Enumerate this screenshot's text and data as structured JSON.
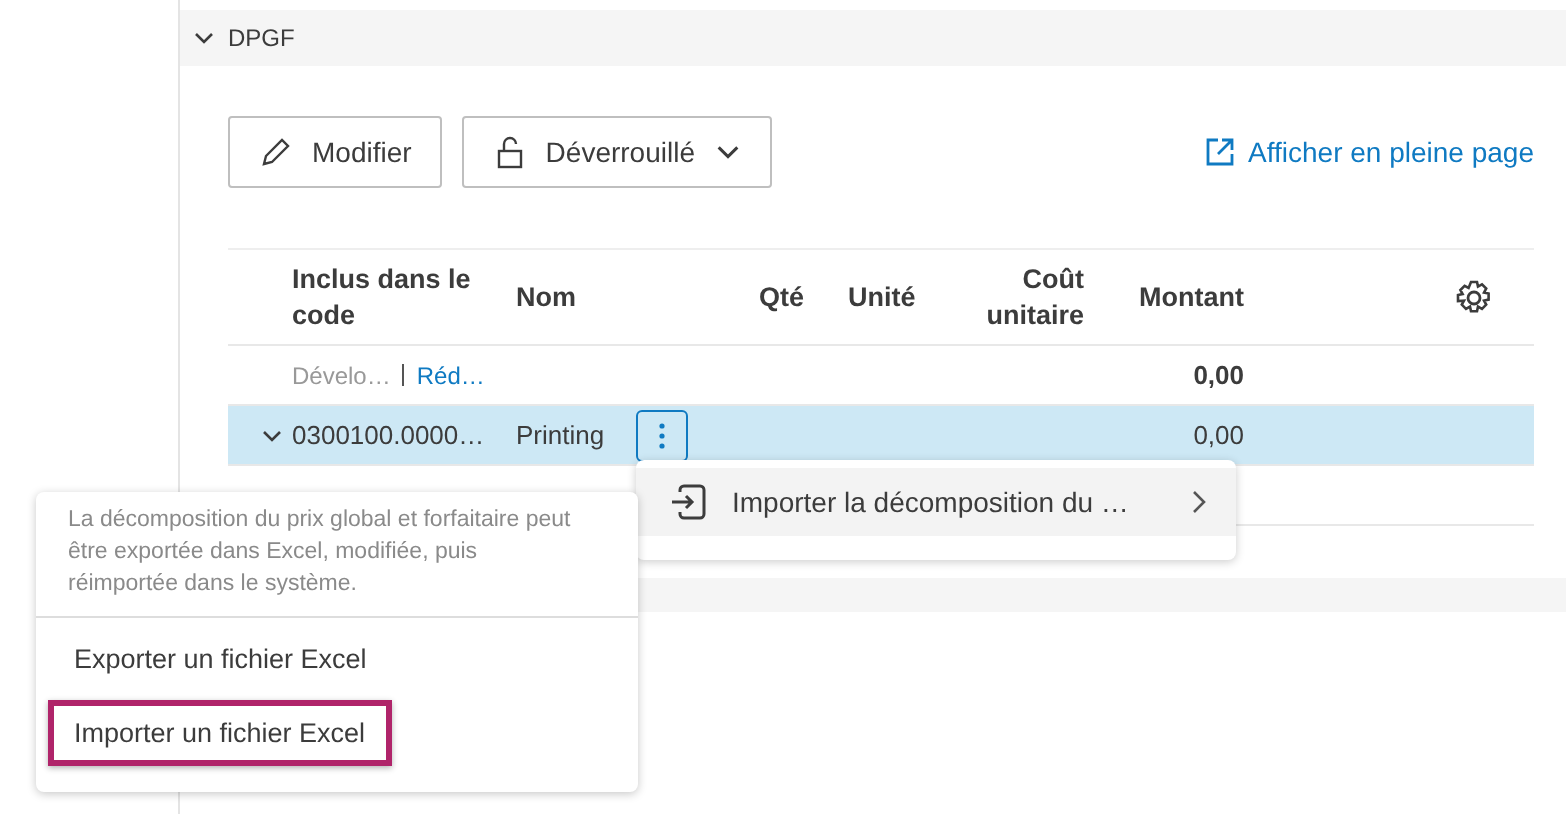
{
  "section": {
    "title": "DPGF",
    "expanded": true
  },
  "toolbar": {
    "edit_button": "Modifier",
    "lock_button": "Déverrouillé",
    "open_link": "Afficher en pleine page"
  },
  "table": {
    "columns": [
      "Inclus dans le code",
      "Nom",
      "Qté",
      "Unité",
      "Coût unitaire",
      "Montant"
    ],
    "rows": [
      {
        "kind": "summary",
        "expand_label": "Dévelo…",
        "collapse_label": "Réd…",
        "amount": "0,00",
        "selected": false
      },
      {
        "kind": "item",
        "code": "0300100.0000…",
        "name": "Printing",
        "amount": "0,00",
        "expanded": true,
        "selected": true
      }
    ]
  },
  "submenu": {
    "label": "Importer la décomposition du …"
  },
  "menu": {
    "description": "La décomposition du prix global et forfaitaire peut être exportée dans Excel, modifiée, puis réimportée dans le système.",
    "items": [
      {
        "label": "Exporter un fichier Excel",
        "selected": false
      },
      {
        "label": "Importer un fichier Excel",
        "selected": true
      }
    ]
  }
}
